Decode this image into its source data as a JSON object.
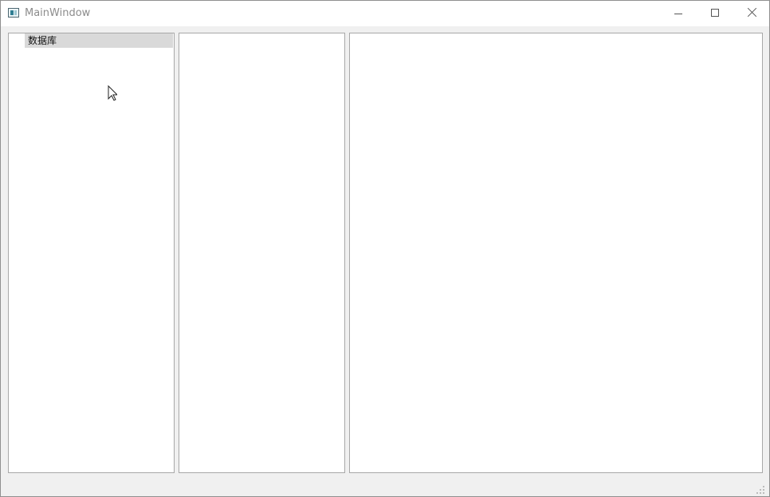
{
  "window": {
    "title": "MainWindow"
  },
  "titlebar": {
    "minimize_icon": "minimize-icon",
    "maximize_icon": "maximize-icon",
    "close_icon": "close-icon"
  },
  "tree_panel": {
    "items": [
      {
        "label": "数据库",
        "selected": true
      }
    ]
  },
  "colors": {
    "titlebar_background": "#ffffff",
    "window_background": "#f0f0f0",
    "panel_background": "#ffffff",
    "panel_border": "#a8a8a8",
    "selection_background": "#d9d9d9",
    "title_text": "#8c8c8c"
  }
}
